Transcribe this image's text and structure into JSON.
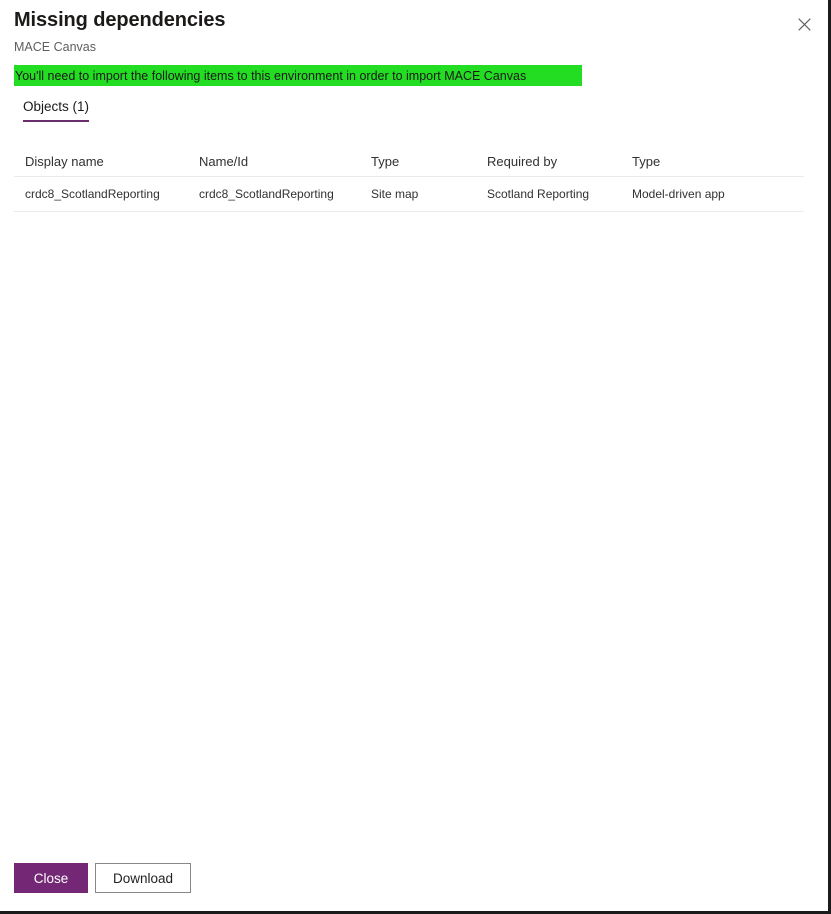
{
  "dialog": {
    "title": "Missing dependencies",
    "subtitle": "MACE Canvas",
    "close_icon_label": "Close",
    "banner": {
      "text": "You'll need to import the following items to this environment in order to import MACE Canvas",
      "background_color": "#22dd22"
    }
  },
  "tabs": [
    {
      "label": "Objects (1)",
      "active": true
    }
  ],
  "table": {
    "columns": [
      "Display name",
      "Name/Id",
      "Type",
      "Required by",
      "Type"
    ],
    "rows": [
      {
        "display_name": "crdc8_ScotlandReporting",
        "name_id": "crdc8_ScotlandReporting",
        "type": "Site map",
        "required_by": "Scotland Reporting",
        "required_by_type": "Model-driven app"
      }
    ]
  },
  "footer": {
    "close_label": "Close",
    "download_label": "Download",
    "primary_color": "#742774"
  }
}
